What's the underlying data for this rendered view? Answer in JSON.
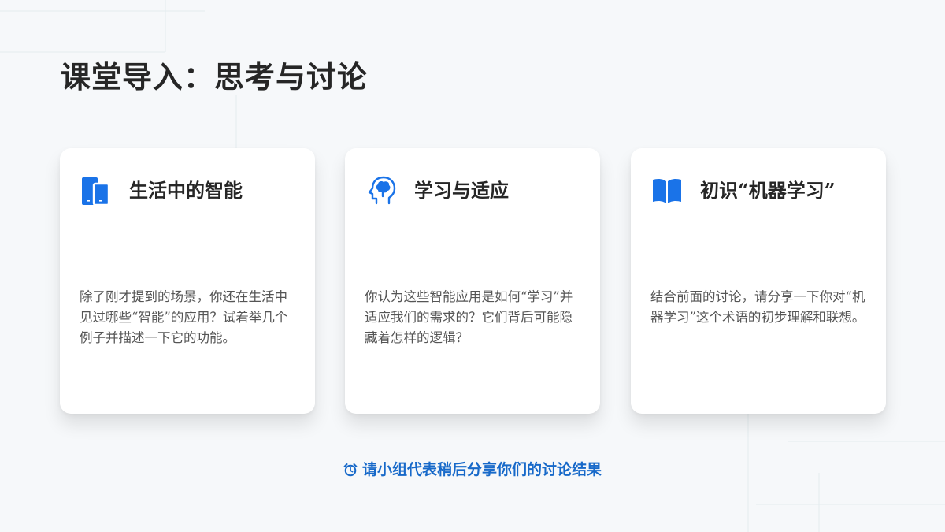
{
  "page": {
    "title": "课堂导入：思考与讨论"
  },
  "cards": [
    {
      "icon": "tablet-phone-icon",
      "title": "生活中的智能",
      "body": "除了刚才提到的场景，你还在生活中见过哪些“智能”的应用？试着举几个例子并描述一下它的功能。"
    },
    {
      "icon": "brain-head-icon",
      "title": "学习与适应",
      "body": "你认为这些智能应用是如何“学习”并适应我们的需求的？它们背后可能隐藏着怎样的逻辑？"
    },
    {
      "icon": "open-book-icon",
      "title": "初识“机器学习”",
      "body": "结合前面的讨论，请分享一下你对“机器学习”这个术语的初步理解和联想。"
    }
  ],
  "footer": {
    "icon": "alarm-clock-icon",
    "text": "请小组代表稍后分享你们的讨论结果"
  },
  "colors": {
    "accent": "#1769c9",
    "icon_blue": "#1a73e8",
    "background": "#f6f8fa",
    "card": "#ffffff"
  }
}
